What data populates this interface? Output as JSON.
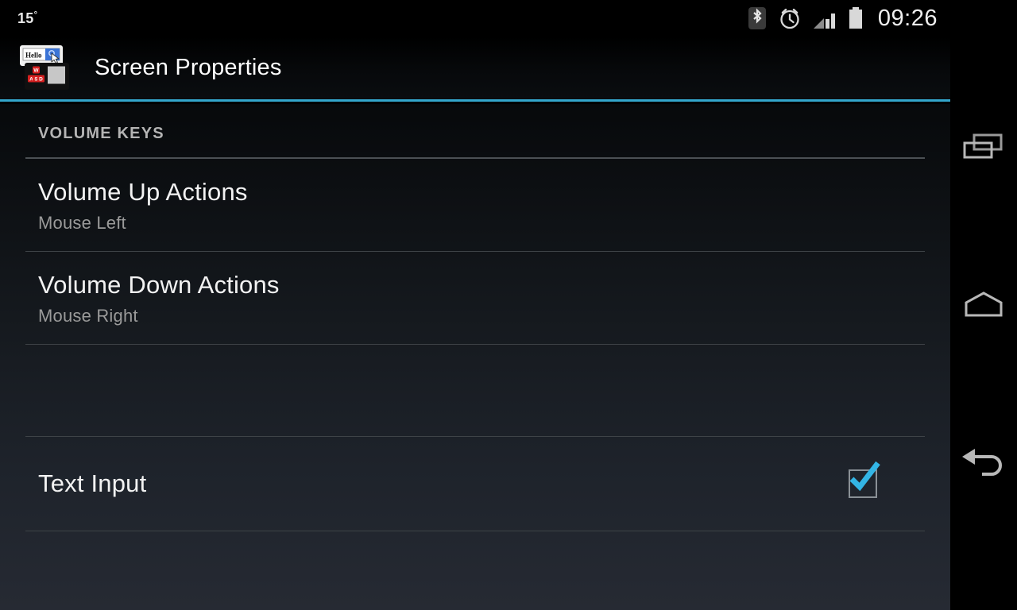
{
  "status_bar": {
    "temperature": "15",
    "degree_symbol": "°",
    "icons": [
      "bluetooth-icon",
      "alarm-clock-icon",
      "signal-bars-icon",
      "battery-icon"
    ],
    "time": "09:26"
  },
  "action_bar": {
    "app_icon_name": "screen-properties-app-icon",
    "app_icon_window_text": "Hello",
    "app_icon_keys": [
      "W",
      "A",
      "S",
      "D"
    ],
    "title": "Screen Properties",
    "accent_color": "#33a6cc"
  },
  "content": {
    "section_header": "VOLUME KEYS",
    "preferences": [
      {
        "title": "Volume Up Actions",
        "summary": "Mouse Left"
      },
      {
        "title": "Volume Down Actions",
        "summary": "Mouse Right"
      }
    ],
    "checkbox_preference": {
      "title": "Text Input",
      "checked": true,
      "check_color": "#33b5e5"
    }
  },
  "nav_bar": {
    "buttons": [
      {
        "name": "recent-apps-button",
        "icon": "recent-apps-icon"
      },
      {
        "name": "home-button",
        "icon": "home-icon"
      },
      {
        "name": "back-button",
        "icon": "back-arrow-icon"
      }
    ]
  }
}
